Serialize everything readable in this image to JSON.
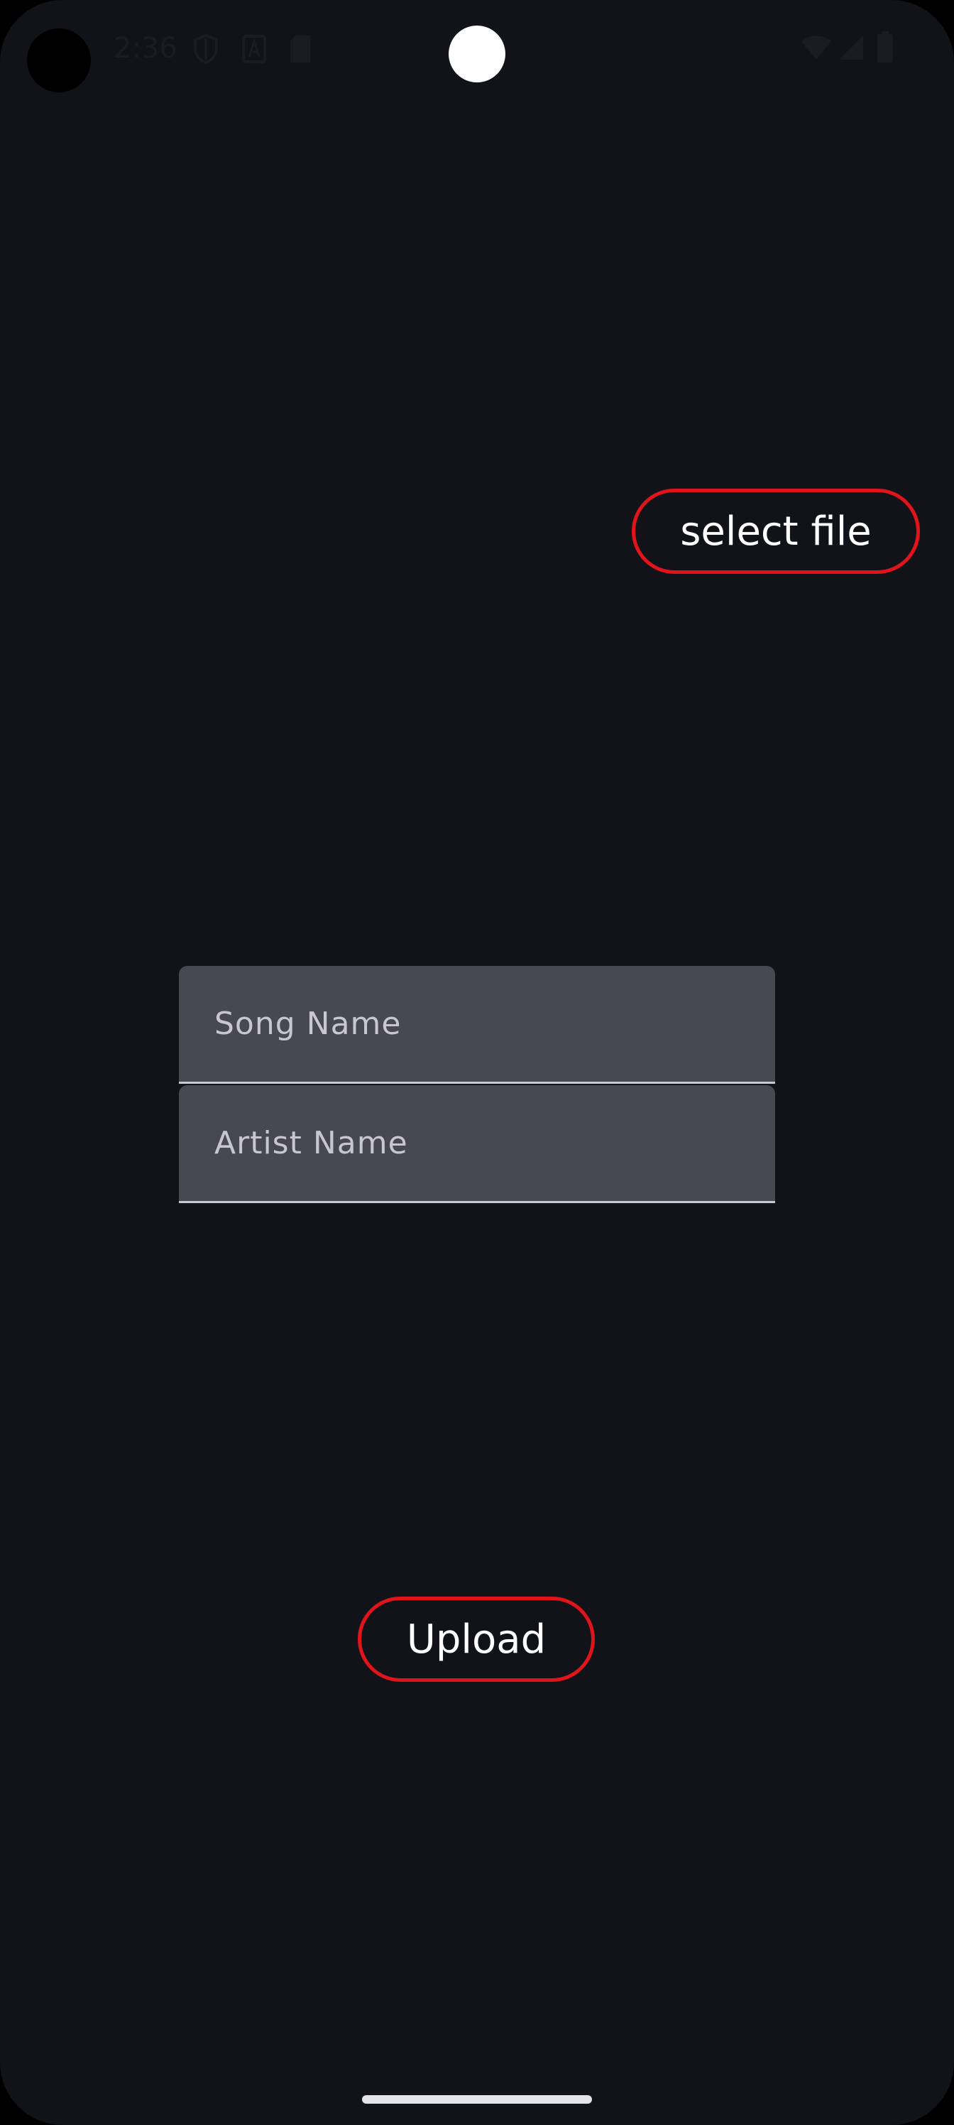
{
  "status_bar": {
    "time": "2:36",
    "icons": [
      "shield-icon",
      "font-a-icon",
      "sd-card-icon",
      "wifi-icon",
      "signal-icon",
      "battery-icon"
    ]
  },
  "main": {
    "select_file_label": "select file",
    "song_name_placeholder": "Song Name",
    "song_name_value": "",
    "artist_name_placeholder": "Artist Name",
    "artist_name_value": "",
    "upload_label": "Upload"
  },
  "colors": {
    "background": "#121318",
    "button_border": "#e0141a",
    "field_background": "#484852"
  }
}
